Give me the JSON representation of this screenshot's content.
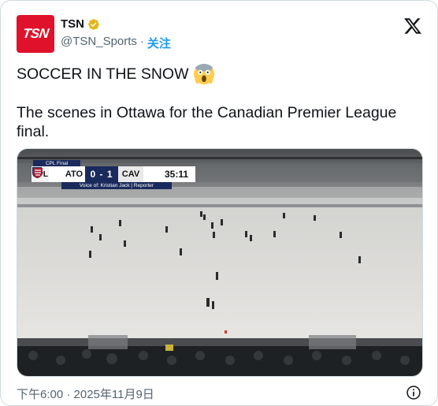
{
  "account": {
    "avatar_text": "TSN",
    "name": "TSN",
    "handle": "@TSN_Sports",
    "separator": "·",
    "follow_label": "关注"
  },
  "post": {
    "line1": "SOCCER IN THE SNOW",
    "line2": "The scenes in Ottawa for the Canadian Premier League final."
  },
  "scorebug": {
    "league_label": "CPL Final",
    "league_short": "CPL",
    "home_team": "ATO",
    "score": "0 - 1",
    "away_team": "CAV",
    "clock": "35:11",
    "credit": "Voice of: Kristian Jack | Reporter"
  },
  "footer": {
    "timestamp": "下午6:00 · 2025年11月9日"
  },
  "icons": {
    "verified": "verified-badge-icon",
    "x_logo": "x-logo-icon",
    "emoji": "screaming-face-emoji",
    "info": "info-icon"
  },
  "colors": {
    "brand_red": "#e0122b",
    "link_blue": "#1d9bf0",
    "verified_gold": "#e2b719",
    "muted": "#536471",
    "scorebug_navy": "#1b2a5c"
  }
}
